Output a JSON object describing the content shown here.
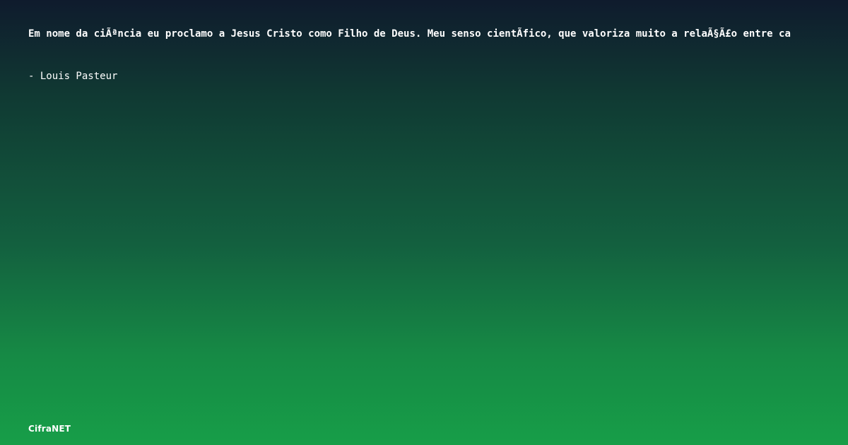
{
  "quote": {
    "text": "Em nome da ciÃªncia eu proclamo a Jesus Cristo como Filho de Deus. Meu senso cientÃ­fico, que valoriza muito a relaÃ§Ã£o entre ca"
  },
  "author": {
    "text": "- Louis Pasteur"
  },
  "brand": {
    "text": "CifraNET"
  }
}
